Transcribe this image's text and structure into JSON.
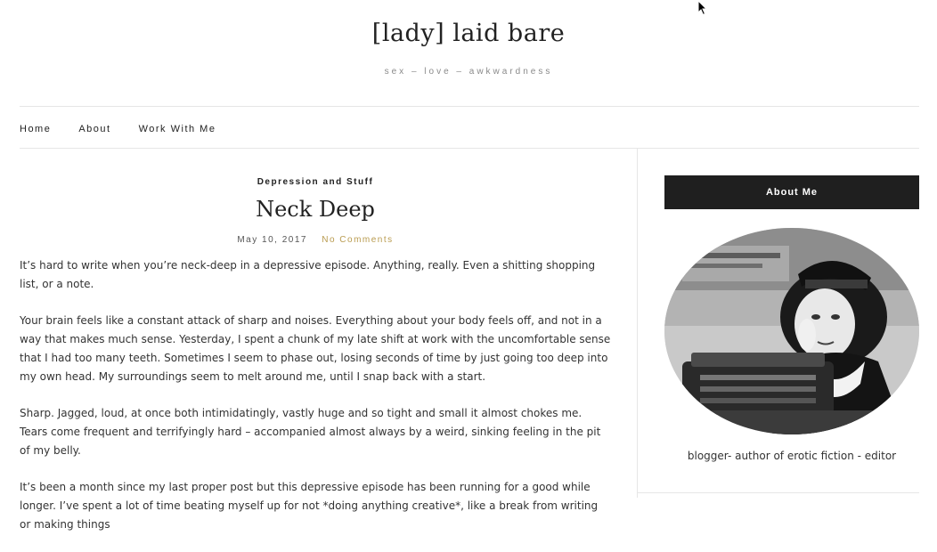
{
  "site": {
    "title": "[lady] laid bare",
    "tagline": "sex – love – awkwardness"
  },
  "nav": {
    "items": [
      {
        "label": "Home"
      },
      {
        "label": "About"
      },
      {
        "label": "Work With Me"
      }
    ]
  },
  "post": {
    "category": "Depression and Stuff",
    "title": "Neck Deep",
    "date": "May 10, 2017",
    "comments": "No Comments",
    "paragraphs": [
      "It’s hard to write when you’re neck-deep in a depressive episode. Anything, really. Even a shitting shopping list, or a note.",
      "Your brain feels like a constant attack of sharp and noises. Everything about your body feels off, and not in a way that makes much sense. Yesterday, I spent a chunk of my late shift at work with the uncomfortable sense that I had too many teeth. Sometimes I seem to phase out, losing seconds of time by just going too deep into my own head. My surroundings seem to melt around me, until I snap back with a start.",
      "Sharp. Jagged, loud, at once both intimidatingly, vastly huge and so tight and small it almost chokes me. Tears come frequent and terrifyingly hard – accompanied almost always by a weird, sinking feeling in the pit of my belly.",
      "It’s been a month since my last proper post but this depressive episode has been running for a good while longer. I’ve spent a lot of time beating myself up for not *doing anything creative*, like a break from writing or making things"
    ]
  },
  "sidebar": {
    "widget_title": "About Me",
    "bio": "blogger- author of erotic fiction - editor"
  },
  "colors": {
    "accent": "#b99b4f",
    "widget_bg": "#1f1f1f",
    "text": "#333333"
  }
}
